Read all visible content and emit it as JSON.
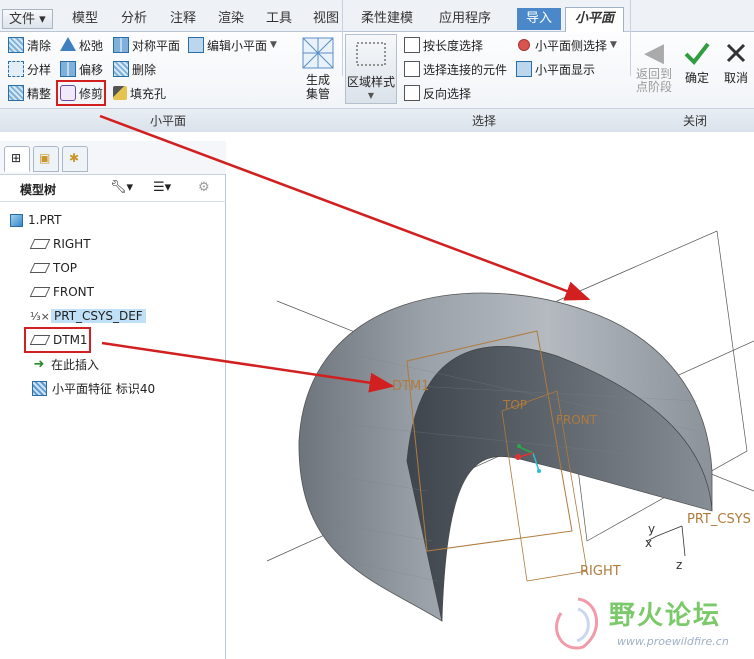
{
  "menubar": {
    "file": "文件",
    "tabs": [
      "模型",
      "分析",
      "注释",
      "渲染",
      "工具",
      "视图",
      "柔性建模",
      "应用程序"
    ],
    "import_tab": "导入",
    "active_tab": "小平面"
  },
  "ribbon": {
    "col1": [
      "清除",
      "分样",
      "精整"
    ],
    "col2": [
      "松弛",
      "偏移",
      "修剪"
    ],
    "col3": [
      "对称平面",
      "删除",
      "填充孔"
    ],
    "col4": [
      "编辑小平面"
    ],
    "generate": "生成\n集管",
    "area_style": "区域样式",
    "select_col": [
      "按长度选择",
      "选择连接的元件",
      "反向选择"
    ],
    "facet_col": [
      "小平面侧选择",
      "小平面显示"
    ],
    "back": "返回到\n点阶段",
    "ok": "确定",
    "cancel": "取消",
    "groups": [
      "小平面",
      "选择",
      "关闭"
    ]
  },
  "left_panel": {
    "title": "模型树",
    "items": [
      {
        "label": "1.PRT",
        "icon": "part-icon"
      },
      {
        "label": "RIGHT",
        "icon": "datum-plane-icon"
      },
      {
        "label": "TOP",
        "icon": "datum-plane-icon"
      },
      {
        "label": "FRONT",
        "icon": "datum-plane-icon"
      },
      {
        "label": "PRT_CSYS_DEF",
        "icon": "csys-icon"
      },
      {
        "label": "DTM1",
        "icon": "datum-plane-icon"
      },
      {
        "label": "在此插入",
        "icon": "insert-arrow-icon"
      },
      {
        "label": "小平面特征 标识40",
        "icon": "facet-feature-icon"
      }
    ]
  },
  "viewport": {
    "labels": [
      "DTM1",
      "TOP",
      "FRONT",
      "RIGHT",
      "PRT_CSYS"
    ],
    "axes": [
      "y",
      "x",
      "z"
    ]
  },
  "watermark": {
    "brand": "野火论坛",
    "url": "www.proewildfire.cn"
  },
  "colors": {
    "annotation": "#d21f1f",
    "datum": "#b07a3c",
    "import_tab": "#4a88c9",
    "ok": "#2f9e3f"
  }
}
